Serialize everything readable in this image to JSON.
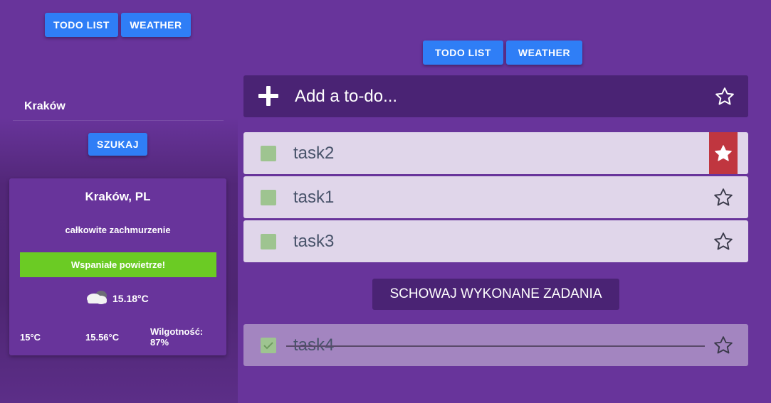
{
  "left": {
    "nav": {
      "todo_label": "TODO LIST",
      "weather_label": "WEATHER"
    },
    "city_value": "Kraków",
    "search_label": "SZUKAJ",
    "weather": {
      "location": "Kraków, PL",
      "description": "całkowite zachmurzenie",
      "air_quality": "Wspaniałe powietrze!",
      "air_quality_color": "#6bcb24",
      "icon": "cloud-icon",
      "temperature": "15.18°C",
      "min_temp": "15°C",
      "max_temp": "15.56°C",
      "humidity_label": "Wilgotność:",
      "humidity_value": "87%"
    }
  },
  "right": {
    "nav": {
      "todo_label": "TODO LIST",
      "weather_label": "WEATHER"
    },
    "add_placeholder": "Add a to-do...",
    "tasks": [
      {
        "label": "task2",
        "favorite": true,
        "done": false
      },
      {
        "label": "task1",
        "favorite": false,
        "done": false
      },
      {
        "label": "task3",
        "favorite": false,
        "done": false
      }
    ],
    "hide_done_label": "SCHOWAJ WYKONANE ZADANIA",
    "done_tasks": [
      {
        "label": "task4",
        "favorite": false,
        "done": true
      }
    ]
  },
  "colors": {
    "background": "#68349b",
    "button": "#2f7ef6",
    "favorite": "#c0363f",
    "checkbox": "#9ec490"
  }
}
